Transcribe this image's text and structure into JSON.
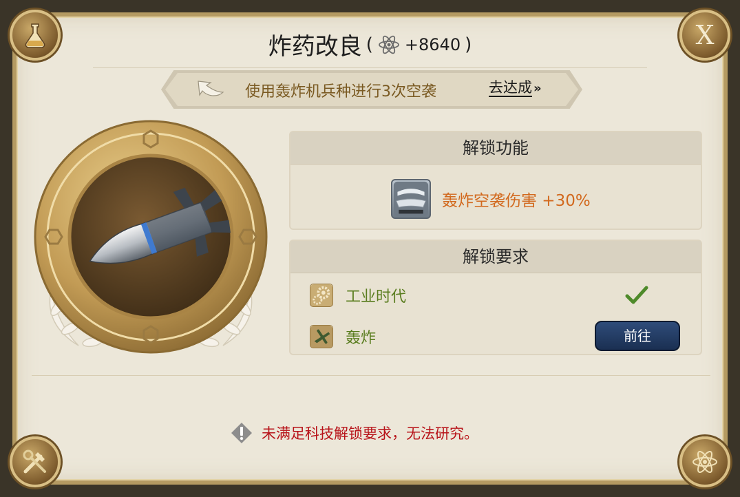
{
  "header": {
    "title": "炸药改良",
    "paren_open": "(",
    "cost_value": "+8640",
    "paren_close": ")",
    "cost_icon": "atom-icon",
    "close_label": "X"
  },
  "quest": {
    "text": "使用轰炸机兵种进行3次空袭",
    "go_label": "去达成",
    "go_arrow": "»"
  },
  "unlock_feature": {
    "heading": "解锁功能",
    "items": [
      {
        "icon": "bomber-wing-icon",
        "label": "轰炸空袭伤害 +30%"
      }
    ]
  },
  "unlock_requirements": {
    "heading": "解锁要求",
    "items": [
      {
        "icon": "gears-icon",
        "label": "工业时代",
        "status": "met"
      },
      {
        "icon": "bomber-plane-icon",
        "label": "轰炸",
        "status": "unmet",
        "action_label": "前往"
      }
    ]
  },
  "warning": {
    "icon": "warning-diamond-icon",
    "text": "未满足科技解锁要求，无法研究。"
  },
  "corners": {
    "top_left": "flask-icon",
    "top_right": "close-icon",
    "bottom_left": "tools-icon",
    "bottom_right": "atom-icon"
  },
  "colors": {
    "panel_bg": "#ece7d9",
    "frame_gold": "#b49a62",
    "quest_text": "#7a5a22",
    "feature_text": "#d2691e",
    "requirement_text": "#5a7d1f",
    "check_green": "#4e8a2a",
    "go_button": "#1f355c",
    "warning_red": "#b8141a"
  }
}
